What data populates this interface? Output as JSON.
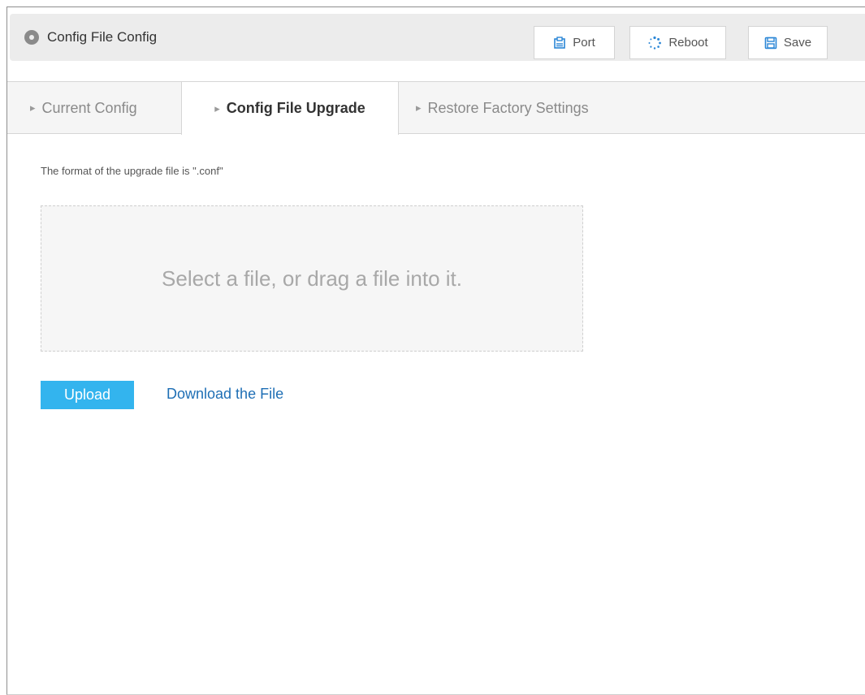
{
  "header": {
    "title": "Config File Config",
    "port_label": "Port",
    "reboot_label": "Reboot",
    "save_label": "Save",
    "icons": {
      "title": "location-pin-icon",
      "port": "port-icon",
      "reboot": "reboot-spinner-icon",
      "save": "save-disk-icon"
    }
  },
  "tabs": [
    {
      "label": "Current Config",
      "active": false
    },
    {
      "label": "Config File Upgrade",
      "active": true
    },
    {
      "label": "Restore Factory Settings",
      "active": false
    }
  ],
  "upgrade": {
    "hint": "The format of the upgrade file is \".conf\"",
    "dropzone_text": "Select a file, or drag a file into it.",
    "upload_label": "Upload",
    "download_label": "Download the File"
  },
  "colors": {
    "accent": "#33b4ee",
    "link": "#1f6fb5",
    "icon_blue": "#2a86d6",
    "header_bg": "#ececec"
  }
}
